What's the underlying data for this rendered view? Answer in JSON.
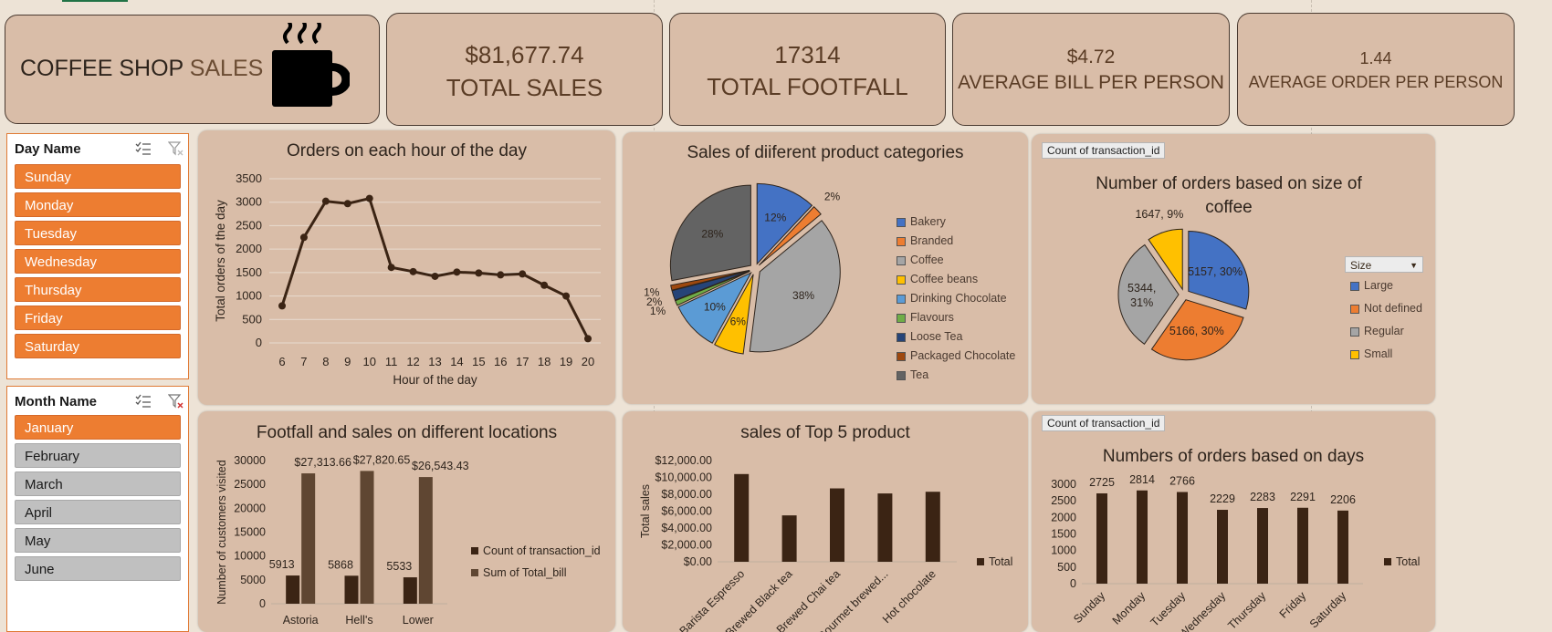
{
  "kpis": {
    "title_left": "COFFEE SHOP",
    "title_right": "SALES",
    "total_sales_value": "$81,677.74",
    "total_sales_label": "TOTAL SALES",
    "total_footfall_value": "17314",
    "total_footfall_label": "TOTAL FOOTFALL",
    "avg_bill_value": "$4.72",
    "avg_bill_label": "AVERAGE BILL PER PERSON",
    "avg_order_value": "1.44",
    "avg_order_label": "AVERAGE ORDER PER PERSON"
  },
  "slicers": {
    "day": {
      "header": "Day Name",
      "items": [
        {
          "label": "Sunday",
          "selected": true
        },
        {
          "label": "Monday",
          "selected": true
        },
        {
          "label": "Tuesday",
          "selected": true
        },
        {
          "label": "Wednesday",
          "selected": true
        },
        {
          "label": "Thursday",
          "selected": true
        },
        {
          "label": "Friday",
          "selected": true
        },
        {
          "label": "Saturday",
          "selected": true
        }
      ]
    },
    "month": {
      "header": "Month Name",
      "items": [
        {
          "label": "January",
          "selected": true
        },
        {
          "label": "February",
          "selected": false
        },
        {
          "label": "March",
          "selected": false
        },
        {
          "label": "April",
          "selected": false
        },
        {
          "label": "May",
          "selected": false
        },
        {
          "label": "June",
          "selected": false
        }
      ]
    }
  },
  "colors": {
    "dark_brown": "#3b2414",
    "mid_brown": "#5f4632",
    "orange": "#ed7d31",
    "panel": "#d9bda8",
    "blue": "#4472c4",
    "gray": "#a5a5a5",
    "gold": "#ffc000",
    "darkgray": "#595959"
  },
  "chart_data": [
    {
      "type": "line",
      "title": "Orders on each hour of the day",
      "xlabel": "Hour of the day",
      "ylabel": "Total orders of the day",
      "x": [
        6,
        7,
        8,
        9,
        10,
        11,
        12,
        13,
        14,
        15,
        16,
        17,
        18,
        19,
        20
      ],
      "values": [
        790,
        2250,
        3020,
        2970,
        3080,
        1610,
        1520,
        1420,
        1510,
        1490,
        1450,
        1470,
        1230,
        1000,
        90
      ],
      "ylim": [
        0,
        3500
      ],
      "yticks": [
        "0",
        "500",
        "1000",
        "1500",
        "2000",
        "2500",
        "3000",
        "3500"
      ],
      "grid": true
    },
    {
      "type": "pie",
      "title": "Sales of diiferent product categories",
      "categories": [
        "Bakery",
        "Branded",
        "Coffee",
        "Coffee beans",
        "Drinking Chocolate",
        "Flavours",
        "Loose Tea",
        "Packaged Chocolate",
        "Tea"
      ],
      "values": [
        12,
        2,
        38,
        6,
        10,
        1,
        2,
        1,
        28
      ],
      "labels": [
        "12%",
        "2%",
        "38%",
        "6%",
        "10%",
        "1%",
        "2%",
        "1%",
        "28%"
      ],
      "colors": [
        "#4472c4",
        "#ed7d31",
        "#a5a5a5",
        "#ffc000",
        "#5b9bd5",
        "#70ad47",
        "#264478",
        "#9e480e",
        "#636363"
      ],
      "legend": "right"
    },
    {
      "type": "pie",
      "title": "Number of orders based on size of coffee",
      "field_button": "Count of transaction_id",
      "legend_header": "Size",
      "categories": [
        "Large",
        "Not defined",
        "Regular",
        "Small"
      ],
      "values": [
        5157,
        5166,
        5344,
        1647
      ],
      "labels": [
        "5157, 30%",
        "5166, 30%",
        "5344, 31%",
        "1647, 9%"
      ],
      "colors": [
        "#4472c4",
        "#ed7d31",
        "#a5a5a5",
        "#ffc000"
      ],
      "legend": "right"
    },
    {
      "type": "bar",
      "title": "Footfall and sales on different locations",
      "ylabel": "Number of customers visited",
      "categories": [
        "Astoria",
        "Hell's",
        "Lower"
      ],
      "series": [
        {
          "name": "Count of transaction_id",
          "values": [
            5913,
            5868,
            5533
          ],
          "labels": [
            "5913",
            "5868",
            "5533"
          ]
        },
        {
          "name": "Sum of Total_bill",
          "values": [
            27313.66,
            27820.65,
            26543.43
          ],
          "labels": [
            "$27,313.66",
            "$27,820.65",
            "$26,543.43"
          ]
        }
      ],
      "ylim": [
        0,
        30000
      ],
      "yticks": [
        "0",
        "5000",
        "10000",
        "15000",
        "20000",
        "25000",
        "30000"
      ],
      "legend": "right"
    },
    {
      "type": "bar",
      "title": "sales of Top 5 product",
      "ylabel": "Total sales",
      "categories": [
        "Barista Espresso",
        "Brewed Black tea",
        "Brewed Chai tea",
        "Gourmet brewed...",
        "Hot chocolate"
      ],
      "series": [
        {
          "name": "Total",
          "values": [
            10400,
            5500,
            8700,
            8100,
            8300
          ]
        }
      ],
      "ylim": [
        0,
        12000
      ],
      "yticks": [
        "$0.00",
        "$2,000.00",
        "$4,000.00",
        "$6,000.00",
        "$8,000.00",
        "$10,000.00",
        "$12,000.00"
      ],
      "legend": "right"
    },
    {
      "type": "bar",
      "title": "Numbers of orders based on days",
      "field_button": "Count of transaction_id",
      "categories": [
        "Sunday",
        "Monday",
        "Tuesday",
        "Wednesday",
        "Thursday",
        "Friday",
        "Saturday"
      ],
      "series": [
        {
          "name": "Total",
          "values": [
            2725,
            2814,
            2766,
            2229,
            2283,
            2291,
            2206
          ],
          "labels": [
            "2725",
            "2814",
            "2766",
            "2229",
            "2283",
            "2291",
            "2206"
          ]
        }
      ],
      "ylim": [
        0,
        3000
      ],
      "yticks": [
        "0",
        "500",
        "1000",
        "1500",
        "2000",
        "2500",
        "3000"
      ],
      "legend": "right"
    }
  ]
}
